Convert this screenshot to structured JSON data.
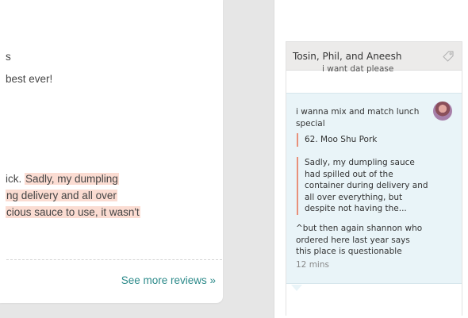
{
  "review": {
    "lines": {
      "line1": "s",
      "line2": "best ever!",
      "line3_plain": "ick. ",
      "line3_hl": "Sadly, my dumpling",
      "line4_hl": "ng delivery and all over",
      "line5_hl": "cious sauce to use, it wasn't"
    },
    "see_more": "See more reviews »"
  },
  "chat": {
    "title": "Tosin, Phil, and Aneesh",
    "tag_icon": "tag-icon",
    "previous_message": "i want dat please",
    "message": {
      "text": "i wanna mix and match lunch special",
      "quote_item": "62. Moo Shu Pork",
      "quote_review": "Sadly, my dumpling sauce had spilled out of the container during delivery and all over everything, but despite not having the...",
      "text2": "^but then again shannon who ordered here last year says this place is questionable",
      "timestamp": "12 mins"
    }
  },
  "colors": {
    "accent_link": "#2c8a8a",
    "highlight": "#fbdcd2",
    "quote_bar": "#e8907a",
    "message_bg": "#e9f4f8",
    "header_bg": "#ecebea"
  }
}
